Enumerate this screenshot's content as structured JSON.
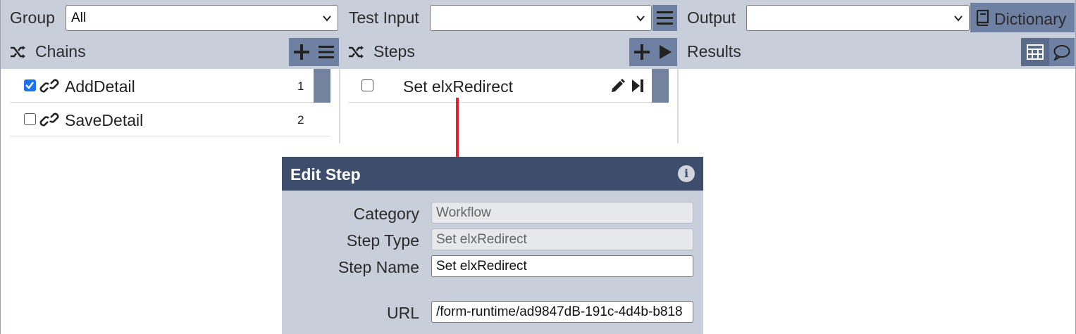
{
  "toolbar": {
    "group_label": "Group",
    "group_value": "All",
    "test_input_label": "Test Input",
    "test_input_value": "",
    "output_label": "Output",
    "output_value": "",
    "dictionary_label": "Dictionary"
  },
  "chains": {
    "title": "Chains",
    "items": [
      {
        "label": "AddDetail",
        "number": "1",
        "checked": true
      },
      {
        "label": "SaveDetail",
        "number": "2",
        "checked": false
      }
    ]
  },
  "steps": {
    "title": "Steps",
    "items": [
      {
        "label": "Set elxRedirect",
        "checked": false
      }
    ]
  },
  "results": {
    "title": "Results"
  },
  "edit_step": {
    "title": "Edit Step",
    "category_label": "Category",
    "category_value": "Workflow",
    "step_type_label": "Step Type",
    "step_type_value": "Set elxRedirect",
    "step_name_label": "Step Name",
    "step_name_value": "Set elxRedirect",
    "url_label": "URL",
    "url_value": "/form-runtime/ad9847dB-191c-4d4b-b818"
  },
  "colors": {
    "panel_bg": "#c8cfdb",
    "button_bg": "#6f81a3",
    "dialog_header": "#3d4d6b",
    "connector": "#e02030",
    "checkbox_checked": "#1a73e8"
  }
}
